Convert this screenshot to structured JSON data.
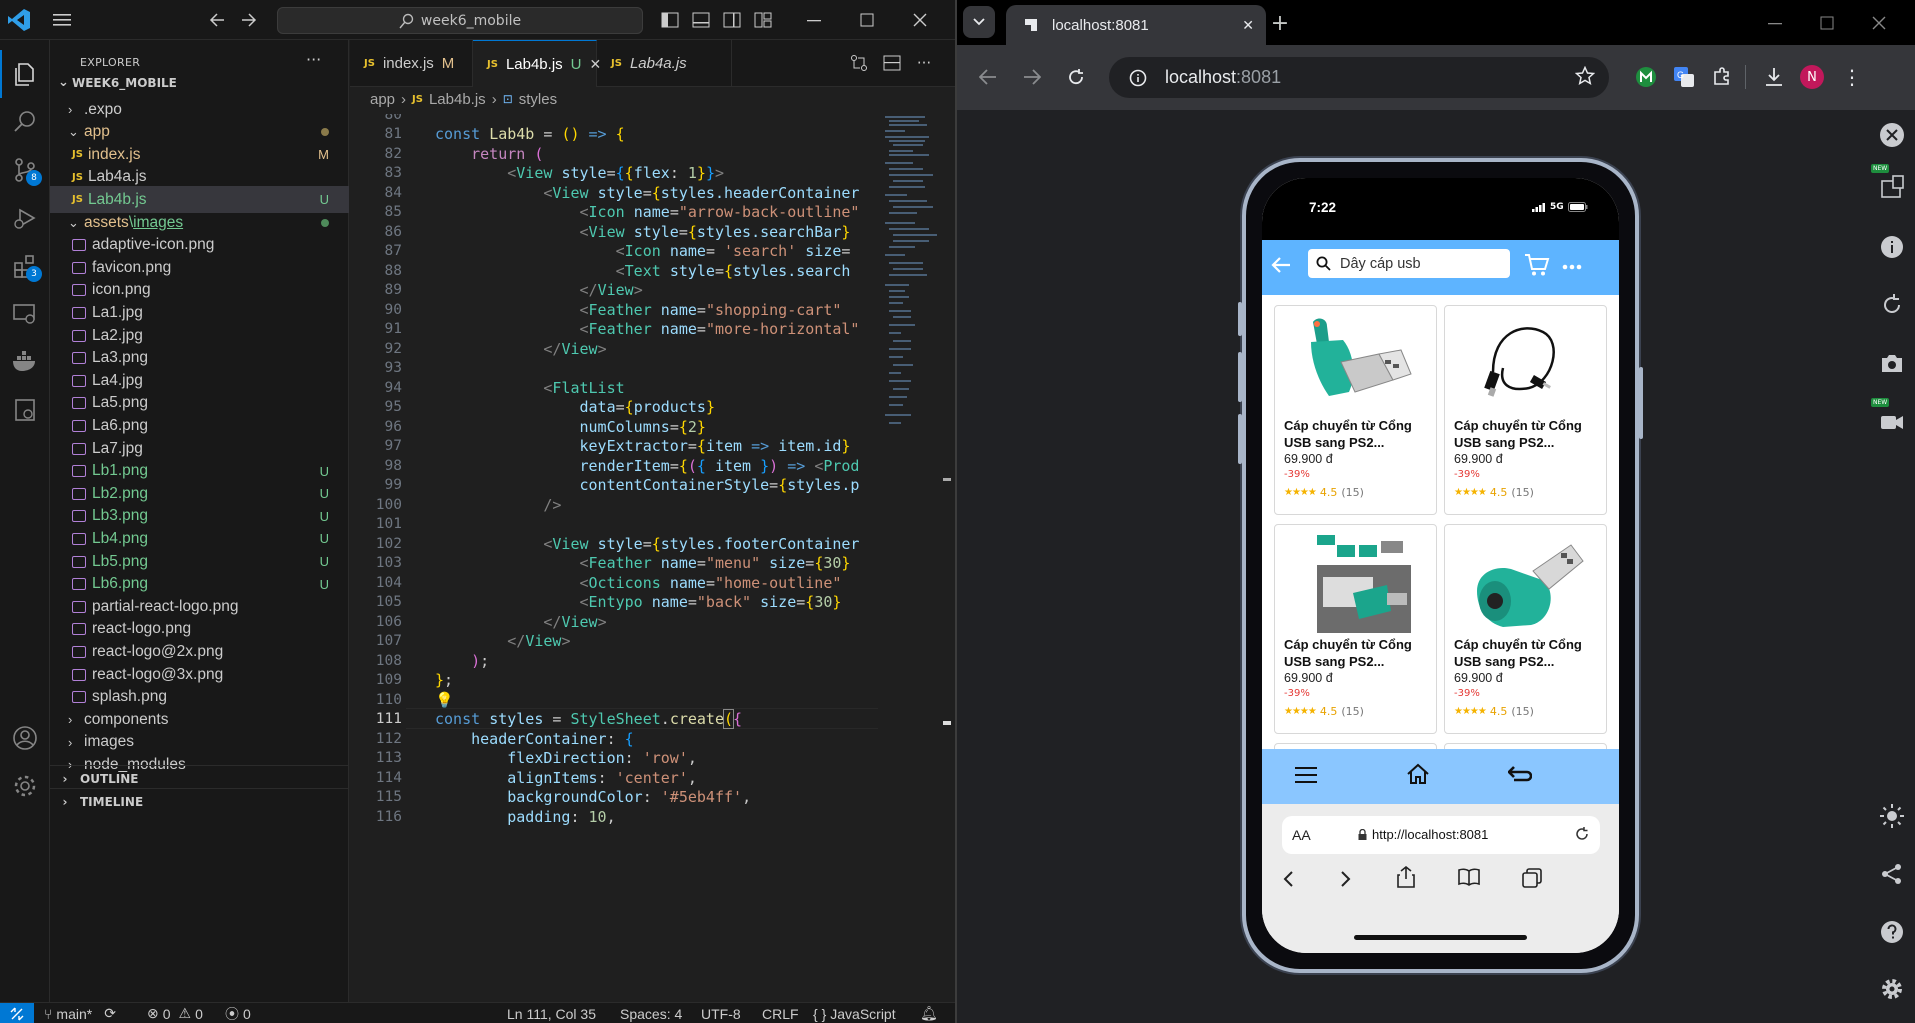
{
  "vscode": {
    "command_center": "week6_mobile",
    "sidebar_title": "EXPLORER",
    "workspace": "WEEK6_MOBILE",
    "tree": [
      {
        "label": ".expo",
        "type": "folder",
        "collapsed": true
      },
      {
        "label": "app",
        "type": "folder",
        "dot": true
      },
      {
        "label": "index.js",
        "type": "js",
        "status": "M"
      },
      {
        "label": "Lab4a.js",
        "type": "js",
        "status": ""
      },
      {
        "label": "Lab4b.js",
        "type": "js",
        "status": "U"
      },
      {
        "label": "assets",
        "sub": "images",
        "type": "folder",
        "dot": true
      },
      {
        "label": "adaptive-icon.png",
        "type": "img",
        "status": ""
      },
      {
        "label": "favicon.png",
        "type": "img",
        "status": ""
      },
      {
        "label": "icon.png",
        "type": "img",
        "status": ""
      },
      {
        "label": "La1.jpg",
        "type": "img",
        "status": ""
      },
      {
        "label": "La2.jpg",
        "type": "img",
        "status": ""
      },
      {
        "label": "La3.png",
        "type": "img",
        "status": ""
      },
      {
        "label": "La4.jpg",
        "type": "img",
        "status": ""
      },
      {
        "label": "La5.png",
        "type": "img",
        "status": ""
      },
      {
        "label": "La6.png",
        "type": "img",
        "status": ""
      },
      {
        "label": "La7.jpg",
        "type": "img",
        "status": ""
      },
      {
        "label": "Lb1.png",
        "type": "img",
        "status": "U"
      },
      {
        "label": "Lb2.png",
        "type": "img",
        "status": "U"
      },
      {
        "label": "Lb3.png",
        "type": "img",
        "status": "U"
      },
      {
        "label": "Lb4.png",
        "type": "img",
        "status": "U"
      },
      {
        "label": "Lb5.png",
        "type": "img",
        "status": "U"
      },
      {
        "label": "Lb6.png",
        "type": "img",
        "status": "U"
      },
      {
        "label": "partial-react-logo.png",
        "type": "img",
        "status": ""
      },
      {
        "label": "react-logo.png",
        "type": "img",
        "status": ""
      },
      {
        "label": "react-logo@2x.png",
        "type": "img",
        "status": ""
      },
      {
        "label": "react-logo@3x.png",
        "type": "img",
        "status": ""
      },
      {
        "label": "splash.png",
        "type": "img",
        "status": ""
      },
      {
        "label": "components",
        "type": "folder",
        "collapsed": true
      },
      {
        "label": "images",
        "type": "folder",
        "collapsed": true
      },
      {
        "label": "node_modules",
        "type": "folder",
        "collapsed": true
      }
    ],
    "outline": "OUTLINE",
    "timeline": "TIMELINE",
    "tabs": [
      {
        "label": "index.js",
        "badge": "M"
      },
      {
        "label": "Lab4b.js",
        "badge": "U",
        "active": true
      },
      {
        "label": "Lab4a.js",
        "badge": ""
      }
    ],
    "breadcrumb": [
      "app",
      "Lab4b.js",
      "styles"
    ],
    "status": {
      "branch": "main*",
      "errors": "0",
      "warnings": "0",
      "ports": "0",
      "position": "Ln 111, Col 35",
      "spaces": "Spaces: 4",
      "encoding": "UTF-8",
      "eol": "CRLF",
      "language": "JavaScript"
    }
  },
  "browser": {
    "tab_title": "localhost:8081",
    "url_host": "localhost",
    "url_port": ":8081",
    "avatar": "N",
    "new_badge": "NEW"
  },
  "phone": {
    "time": "7:22",
    "network": "5G",
    "search_text": "Dây cáp usb",
    "products": [
      {
        "name": "Cáp chuyển từ Cổng USB sang PS2...",
        "price": "69.900 đ",
        "discount": "-39%",
        "rating": "4.5",
        "reviews": "(15)",
        "img": "usb-green"
      },
      {
        "name": "Cáp chuyển từ Cổng USB sang PS2...",
        "price": "69.900 đ",
        "discount": "-39%",
        "rating": "4.5",
        "reviews": "(15)",
        "img": "cable-black"
      },
      {
        "name": "Cáp chuyển từ Cổng USB sang PS2...",
        "price": "69.900 đ",
        "discount": "-39%",
        "rating": "4.5",
        "reviews": "(15)",
        "img": "adapter-photo"
      },
      {
        "name": "Cáp chuyển từ Cổng USB sang PS2...",
        "price": "69.900 đ",
        "discount": "-39%",
        "rating": "4.5",
        "reviews": "(15)",
        "img": "usb-green-2"
      }
    ],
    "safari_aa": "AA",
    "safari_url": "http://localhost:8081"
  }
}
